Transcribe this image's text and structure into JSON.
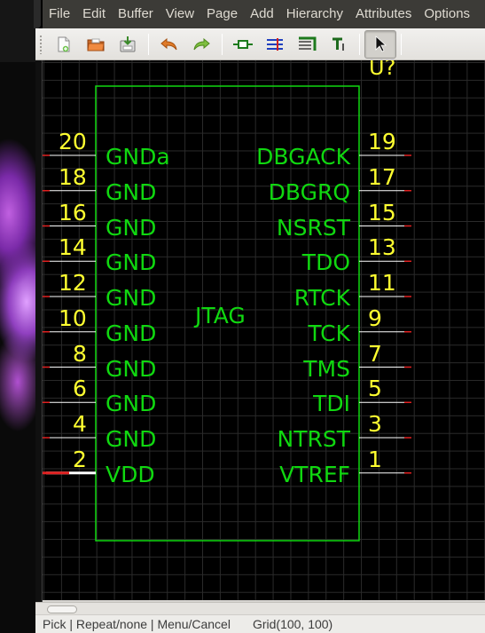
{
  "menubar": {
    "items": [
      "File",
      "Edit",
      "Buffer",
      "View",
      "Page",
      "Add",
      "Hierarchy",
      "Attributes",
      "Options"
    ]
  },
  "toolbar": {
    "buttons": [
      "new-file-icon",
      "open-file-icon",
      "save-file-icon",
      "undo-icon",
      "redo-icon",
      "add-component-icon",
      "add-net-icon",
      "add-bus-icon",
      "add-text-icon",
      "select-pointer-icon"
    ]
  },
  "schematic": {
    "refdes": "U?",
    "device": "JTAG",
    "colors": {
      "outline": "#10d810",
      "pin_number": "#ffff30",
      "pin_label": "#10d810",
      "pin_line": "#ffffff",
      "pin_end": "#e02020",
      "grid": "#2a2a2a"
    },
    "left_pins": [
      {
        "number": "20",
        "label": "GNDa"
      },
      {
        "number": "18",
        "label": "GND"
      },
      {
        "number": "16",
        "label": "GND"
      },
      {
        "number": "14",
        "label": "GND"
      },
      {
        "number": "12",
        "label": "GND"
      },
      {
        "number": "10",
        "label": "GND"
      },
      {
        "number": "8",
        "label": "GND"
      },
      {
        "number": "6",
        "label": "GND"
      },
      {
        "number": "4",
        "label": "GND"
      },
      {
        "number": "2",
        "label": "VDD"
      }
    ],
    "right_pins": [
      {
        "number": "19",
        "label": "DBGACK"
      },
      {
        "number": "17",
        "label": "DBGRQ"
      },
      {
        "number": "15",
        "label": "NSRST"
      },
      {
        "number": "13",
        "label": "TDO"
      },
      {
        "number": "11",
        "label": "RTCK"
      },
      {
        "number": "9",
        "label": "TCK"
      },
      {
        "number": "7",
        "label": "TMS"
      },
      {
        "number": "5",
        "label": "TDI"
      },
      {
        "number": "3",
        "label": "NTRST"
      },
      {
        "number": "1",
        "label": "VTREF"
      }
    ]
  },
  "statusbar": {
    "modes": "Pick | Repeat/none | Menu/Cancel",
    "grid": "Grid(100, 100)"
  }
}
